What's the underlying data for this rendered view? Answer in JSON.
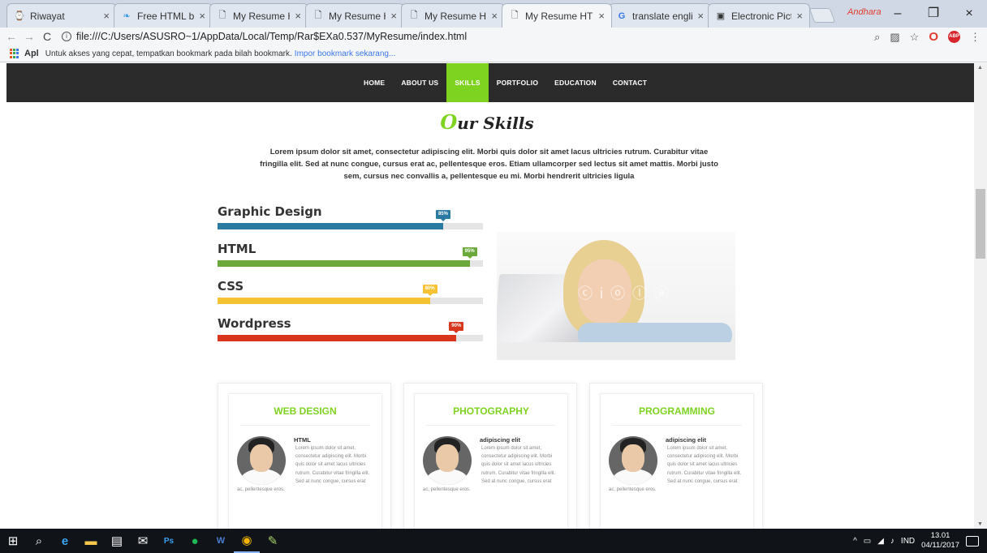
{
  "browser": {
    "tabs": [
      {
        "label": "Riwayat",
        "icon": "history-icon",
        "active": false
      },
      {
        "label": "Free HTML bootst",
        "icon": "bootstrap-icon",
        "active": false
      },
      {
        "label": "My Resume HTML",
        "icon": "page-icon",
        "active": false
      },
      {
        "label": "My Resume HTML",
        "icon": "page-icon",
        "active": false
      },
      {
        "label": "My Resume HTML",
        "icon": "page-icon",
        "active": false
      },
      {
        "label": "My Resume HTML",
        "icon": "page-icon",
        "active": true
      },
      {
        "label": "translate english i",
        "icon": "google-icon",
        "active": false
      },
      {
        "label": "Electronic Picture",
        "icon": "camera-icon",
        "active": false
      }
    ],
    "profile_name": "Andhara",
    "url": "file:///C:/Users/ASUSRO~1/AppData/Local/Temp/Rar$EXa0.537/MyResume/index.html",
    "bookmarks": {
      "apps_label": "Apl",
      "hint": "Untuk akses yang cepat, tempatkan bookmark pada bilah bookmark.",
      "link": "Impor bookmark sekarang..."
    }
  },
  "site": {
    "nav": [
      {
        "label": "HOME",
        "active": false
      },
      {
        "label": "ABOUT US",
        "active": false
      },
      {
        "label": "SKILLS",
        "active": true
      },
      {
        "label": "PORTFOLIO",
        "active": false
      },
      {
        "label": "EDUCATION",
        "active": false
      },
      {
        "label": "CONTACT",
        "active": false
      }
    ],
    "section_title_accent": "O",
    "section_title_rest": "ur Skills",
    "intro": "Lorem ipsum dolor sit amet, consectetur adipiscing elit. Morbi quis dolor sit amet lacus ultricies rutrum. Curabitur vitae fringilla elit. Sed at nunc congue, cursus erat ac, pellentesque eros. Etiam ullamcorper sed lectus sit amet mattis. Morbi justo sem, cursus nec convallis a, pellentesque eu mi. Morbi hendrerit ultricies ligula",
    "skills": [
      {
        "name": "Graphic Design",
        "percent": 85,
        "label": "85%",
        "color": "#2a7aa1"
      },
      {
        "name": "HTML",
        "percent": 95,
        "label": "95%",
        "color": "#6aa93a"
      },
      {
        "name": "CSS",
        "percent": 80,
        "label": "80%",
        "color": "#f4c232"
      },
      {
        "name": "Wordpress",
        "percent": 90,
        "label": "90%",
        "color": "#d9361e"
      }
    ],
    "photo_watermark": "ⓒ i ⓞ ⓛ ⓐ",
    "cards": [
      {
        "title": "WEB DESIGN",
        "subtitle": "HTML",
        "text": "Lorem ipsum dolor sit amet, consectetur adipiscing elit. Morbi quis dolor sit amet lacus ultricies rutrum. Curabitur vitae fringilla elit. Sed at nunc congue, cursus erat ac, pellentesque eros."
      },
      {
        "title": "PHOTOGRAPHY",
        "subtitle": "adipiscing elit",
        "text": "Lorem ipsum dolor sit amet, consectetur adipiscing elit. Morbi quis dolor sit amet lacus ultricies rutrum. Curabitur vitae fringilla elit. Sed at nunc congue, cursus erat ac, pellentesque eros."
      },
      {
        "title": "PROGRAMMING",
        "subtitle": "adipiscing elit",
        "text": "Lorem ipsum dolor sit amet, consectetur adipiscing elit. Morbi quis dolor sit amet lacus ultricies rutrum. Curabitur vitae fringilla elit. Sed at nunc congue, cursus erat ac, pellentesque eros."
      }
    ],
    "accent_color": "#7ed321"
  },
  "taskbar": {
    "tray_language": "IND",
    "time": "13.01",
    "date": "04/11/2017"
  }
}
